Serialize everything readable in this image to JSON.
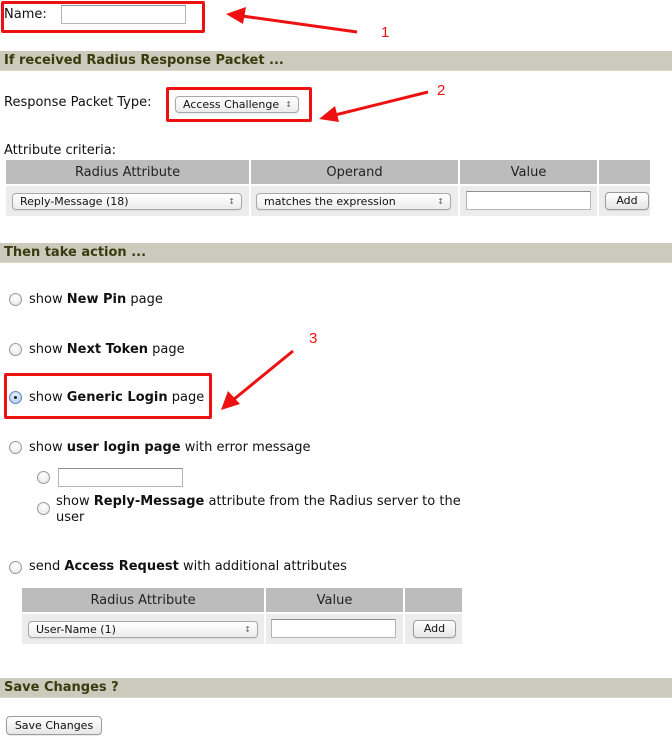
{
  "name_field": {
    "label": "Name:",
    "value": ""
  },
  "sections": {
    "if_received": "If received Radius Response Packet ...",
    "then_action": "Then take action ...",
    "save": "Save Changes ?"
  },
  "response_packet": {
    "label": "Response Packet Type:",
    "selected": "Access Challenge"
  },
  "criteria": {
    "label": "Attribute criteria:",
    "columns": [
      "Radius Attribute",
      "Operand",
      "Value",
      ""
    ],
    "row": {
      "attribute": "Reply-Message (18)",
      "operand": "matches the expression",
      "value": "",
      "add_label": "Add"
    }
  },
  "actions": [
    {
      "pre": "show",
      "bold": "New Pin",
      "post": "page",
      "checked": false
    },
    {
      "pre": "show",
      "bold": "Next Token",
      "post": "page",
      "checked": false
    },
    {
      "pre": "show",
      "bold": "Generic Login",
      "post": "page",
      "checked": true
    },
    {
      "pre": "show",
      "bold": "user login page",
      "post": "with error message",
      "checked": false
    },
    {
      "pre": "send",
      "bold": "Access Request",
      "post": "with additional attributes",
      "checked": false
    }
  ],
  "error_message_options": {
    "custom_value": "",
    "reply_pre": "show",
    "reply_bold": "Reply-Message",
    "reply_post": "attribute from the Radius server to the",
    "reply_post2": "user"
  },
  "access_request_table": {
    "columns": [
      "Radius Attribute",
      "Value",
      ""
    ],
    "row": {
      "attribute": "User-Name (1)",
      "value": "",
      "add_label": "Add"
    }
  },
  "save_button": "Save Changes",
  "annotations": [
    "1",
    "2",
    "3"
  ],
  "select_arrows": "▲▼",
  "colors": {
    "annotation": "#ee1111",
    "section_bar": "#cbcbbd",
    "section_text": "#3a3a0e"
  }
}
